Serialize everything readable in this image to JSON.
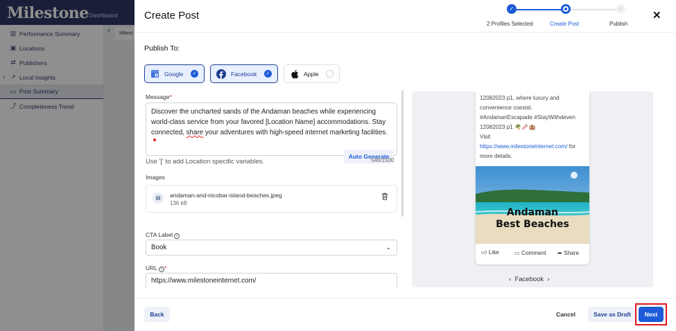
{
  "app": {
    "brand": "Milestone",
    "top_nav": "Dashboard",
    "tab_stub": "Milest"
  },
  "sidebar": {
    "items": [
      {
        "label": "Performance Summary",
        "icon": "chart-bar-icon"
      },
      {
        "label": "Locations",
        "icon": "location-icon"
      },
      {
        "label": "Publishers",
        "icon": "swap-icon"
      },
      {
        "label": "Local Insights",
        "icon": "insights-icon"
      },
      {
        "label": "Post Summary",
        "icon": "post-icon",
        "active": true
      },
      {
        "label": "Completeness Trend",
        "icon": "trend-icon"
      }
    ]
  },
  "modal": {
    "title": "Create Post",
    "close_glyph": "✕",
    "steps": [
      {
        "label": "2 Profiles Selected",
        "state": "done"
      },
      {
        "label": "Create Post",
        "state": "current"
      },
      {
        "label": "Publish",
        "state": "todo"
      }
    ],
    "publish_to_label": "Publish To:",
    "publishers": [
      {
        "label": "Google",
        "selected": true,
        "icon": "google-business-icon"
      },
      {
        "label": "Facebook",
        "selected": true,
        "icon": "facebook-icon"
      },
      {
        "label": "Apple",
        "selected": false,
        "icon": "apple-icon"
      }
    ],
    "message": {
      "label": "Message",
      "required_mark": "*",
      "text_part1": "Discover the uncharted sands of the Andaman beaches while experiencing world-class service from your favored [Location Name] accommodations. Stay connected, ",
      "text_err": "share",
      "text_part2": " your adventures with high-speed internet marketing facilities.",
      "auto_generate": "Auto Generate",
      "hint": "Use '[' to add Location specific variables.",
      "counter": "548/1500"
    },
    "images": {
      "label": "Images",
      "file_name": "andaman-and-nicobar-island-beaches.jpeg",
      "file_size": "136 kB"
    },
    "cta": {
      "label": "CTA Label",
      "info": "i",
      "value": "Book"
    },
    "url": {
      "label": "URL",
      "info": "i",
      "required_mark": "*",
      "value": "https://www.milestoneinternet.com/"
    },
    "preview": {
      "lines": [
        "12082023 p1, where luxury and",
        "convenience coexist.",
        "#AndamanEscapade #StayWithdeven",
        "12082023 p1 🌴🥢🏨",
        "Visit"
      ],
      "link": "https://www.milestoneinternet.com/",
      "link_suffix": " for",
      "after_link": "more details.",
      "image_caption_1": "Andaman",
      "image_caption_2": "Best Beaches",
      "actions": [
        "Like",
        "Comment",
        "Share"
      ],
      "nav_label": "Facebook"
    },
    "footer": {
      "back": "Back",
      "cancel": "Cancel",
      "save_draft": "Save as Draft",
      "next": "Next"
    }
  },
  "colors": {
    "primary": "#1d5bd8",
    "navy": "#1e2a5a",
    "highlight": "#e0141f"
  }
}
